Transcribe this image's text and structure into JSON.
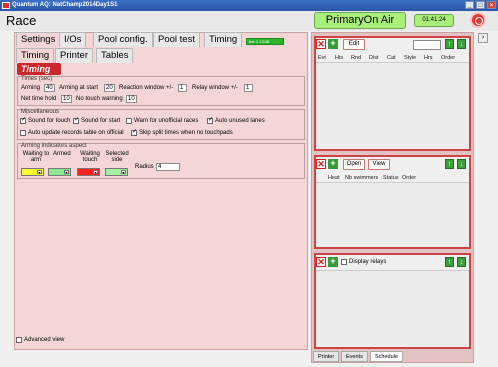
{
  "window": {
    "title": "Quantum AQ: NatChamp2014Day1S1"
  },
  "header": {
    "race_label": "Race",
    "primary_label": "PrimaryOn Air",
    "clock": "01:41:24"
  },
  "main_tabs": [
    "Settings",
    "I/Os",
    "Pool config.",
    "Pool test",
    "Timing"
  ],
  "sub_tabs": [
    "Timing",
    "Printer",
    "Tables"
  ],
  "progress": {
    "text": "bar 1 13:45",
    "color": "#2db52d"
  },
  "section_title": "Timing",
  "times": {
    "title": "Times (sec)",
    "arming_label": "Arming",
    "arming_value": "40",
    "arming_start_label": "Arming at start",
    "arming_start_value": "20",
    "reaction_label": "Reaction window +/-",
    "reaction_value": "1",
    "relay_label": "Relay window +/-",
    "relay_value": "1",
    "net_time_label": "Net time hold",
    "net_time_value": "10",
    "no_touch_label": "No touch warning",
    "no_touch_value": "10"
  },
  "misc": {
    "title": "Miscellaneous",
    "sound_touch": "Sound for touch",
    "sound_start": "Sound for start",
    "warn_unofficial": "Warn for unofficial races",
    "auto_unused": "Auto unused lanes",
    "auto_update": "Auto update records table on official",
    "skip_split": "Skip split times when no touchpads"
  },
  "arming": {
    "title": "Arming indicators aspect",
    "waiting_label": "Waiting to arm",
    "armed_label": "Armed",
    "touch_label": "Waiting touch",
    "selected_label": "Selected side",
    "radius_label": "Radius",
    "radius_value": "4",
    "colors": {
      "waiting": "#ffff33",
      "armed": "#8ee88e",
      "touch": "#ff2020",
      "selected": "#a8f0a8"
    }
  },
  "advanced_view": "Advanced view",
  "panel_events": {
    "edit_label": "Edit",
    "columns": [
      "Evt",
      "Hts",
      "Rnd",
      "Dist",
      "Cat",
      "Style",
      "Hrs",
      "Order"
    ]
  },
  "panel_heats": {
    "open_label": "Open",
    "view_label": "View",
    "columns": [
      "Heat",
      "Nb swimmers",
      "Status",
      "Order"
    ]
  },
  "panel_relays": {
    "display_relays_label": "Display relays"
  },
  "bottom_tabs": [
    "Printer",
    "Events",
    "Schedule"
  ],
  "colors": {
    "accent": "#c9272b",
    "panel_bg": "#f4d6d6",
    "on_air": "#a8f07a"
  }
}
